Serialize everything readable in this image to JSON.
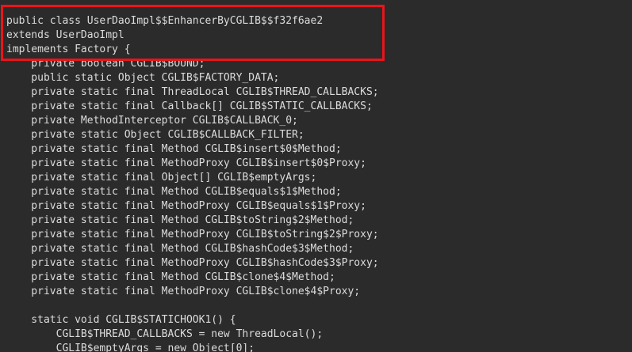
{
  "editor": {
    "lines": [
      "public class UserDaoImpl$$EnhancerByCGLIB$$f32f6ae2",
      "extends UserDaoImpl",
      "implements Factory {",
      "    private boolean CGLIB$BOUND;",
      "    public static Object CGLIB$FACTORY_DATA;",
      "    private static final ThreadLocal CGLIB$THREAD_CALLBACKS;",
      "    private static final Callback[] CGLIB$STATIC_CALLBACKS;",
      "    private MethodInterceptor CGLIB$CALLBACK_0;",
      "    private static Object CGLIB$CALLBACK_FILTER;",
      "    private static final Method CGLIB$insert$0$Method;",
      "    private static final MethodProxy CGLIB$insert$0$Proxy;",
      "    private static final Object[] CGLIB$emptyArgs;",
      "    private static final Method CGLIB$equals$1$Method;",
      "    private static final MethodProxy CGLIB$equals$1$Proxy;",
      "    private static final Method CGLIB$toString$2$Method;",
      "    private static final MethodProxy CGLIB$toString$2$Proxy;",
      "    private static final Method CGLIB$hashCode$3$Method;",
      "    private static final MethodProxy CGLIB$hashCode$3$Proxy;",
      "    private static final Method CGLIB$clone$4$Method;",
      "    private static final MethodProxy CGLIB$clone$4$Proxy;",
      "",
      "    static void CGLIB$STATICHOOK1() {",
      "        CGLIB$THREAD_CALLBACKS = new ThreadLocal();",
      "        CGLIB$emptyArgs = new Object[0];"
    ]
  },
  "colors": {
    "background": "#2b2b2b",
    "text": "#dcdcdc",
    "highlight_border": "#e8151b"
  }
}
